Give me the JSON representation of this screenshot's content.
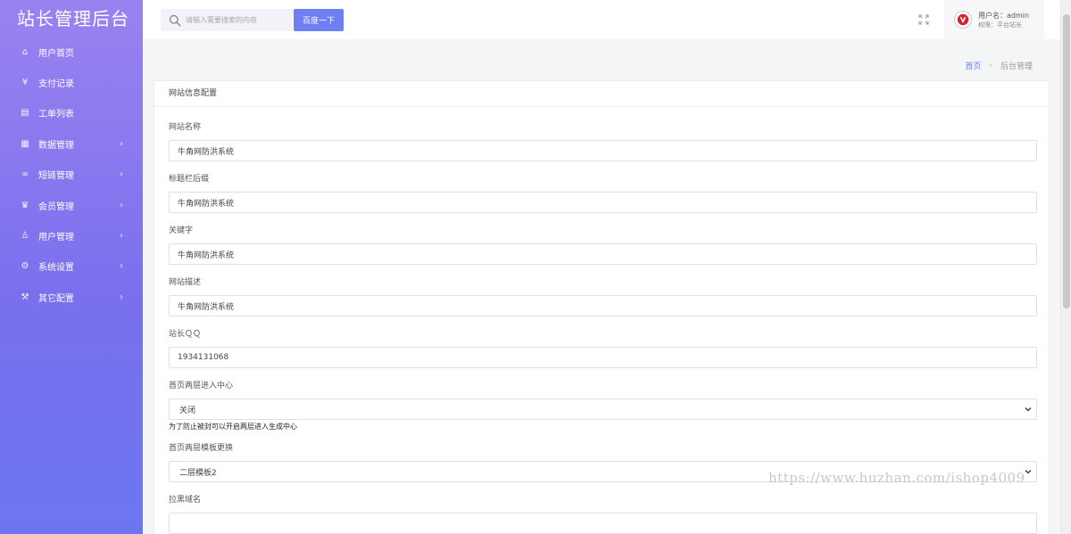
{
  "app_title": "站长管理后台",
  "sidebar": {
    "items": [
      {
        "label": "用户首页",
        "icon": "home-icon",
        "glyph": "⌂",
        "has_submenu": false
      },
      {
        "label": "支付记录",
        "icon": "yen-icon",
        "glyph": "¥",
        "has_submenu": false
      },
      {
        "label": "工单列表",
        "icon": "document-icon",
        "glyph": "▤",
        "has_submenu": false
      },
      {
        "label": "数据管理",
        "icon": "calendar-icon",
        "glyph": "▦",
        "has_submenu": true
      },
      {
        "label": "短链管理",
        "icon": "link-icon",
        "glyph": "∞",
        "has_submenu": true
      },
      {
        "label": "会员管理",
        "icon": "crown-icon",
        "glyph": "♛",
        "has_submenu": true
      },
      {
        "label": "用户管理",
        "icon": "user-icon",
        "glyph": "♙",
        "has_submenu": true
      },
      {
        "label": "系统设置",
        "icon": "gear-icon",
        "glyph": "⚙",
        "has_submenu": true
      },
      {
        "label": "其它配置",
        "icon": "tools-icon",
        "glyph": "⚒",
        "has_submenu": true
      }
    ],
    "arrow_glyph": "›"
  },
  "header": {
    "search_placeholder": "请输入需要搜索的内容",
    "search_button": "百度一下",
    "user_name": "用户名：admin",
    "user_role": "权限：平台站长"
  },
  "breadcrumb": {
    "home": "首页",
    "separator": "›",
    "current": "后台管理"
  },
  "card": {
    "title": "网站信息配置"
  },
  "form": {
    "site_name": {
      "label": "网站名称",
      "value": "牛角网防洪系统"
    },
    "title_suffix": {
      "label": "标题栏后缀",
      "value": "牛角网防洪系统"
    },
    "keywords": {
      "label": "关键字",
      "value": "牛角网防洪系统"
    },
    "description": {
      "label": "网站描述",
      "value": "牛角网防洪系统"
    },
    "qq": {
      "label": "站长ＱＱ",
      "value": "1934131068"
    },
    "two_layer": {
      "label": "首页两层进入中心",
      "value": "关闭",
      "help": "为了防止被封可以开启两层进入生成中心"
    },
    "template": {
      "label": "首页两层模板更换",
      "value": "二层模板2"
    },
    "blacklist": {
      "label": "拉黑域名",
      "value": ""
    }
  },
  "watermark": "https://www.huzhan.com/ishop4009",
  "colors": {
    "sidebar_top": "#9a82f0",
    "sidebar_bottom": "#6c76f0",
    "accent": "#6d7ff2"
  }
}
